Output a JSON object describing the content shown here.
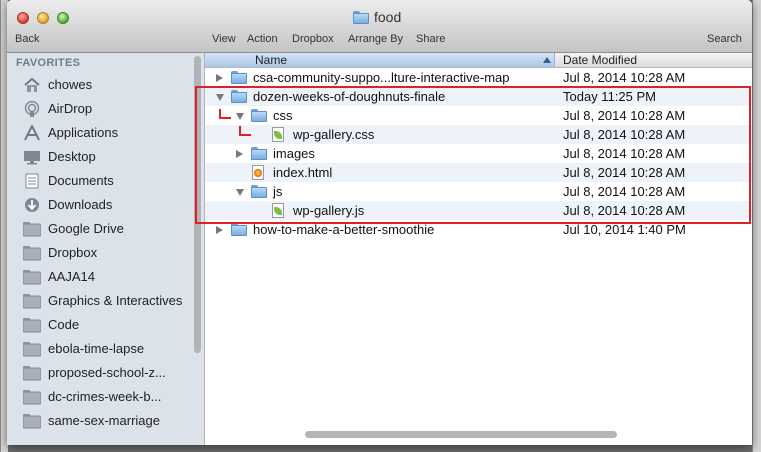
{
  "window": {
    "title": "food"
  },
  "toolbar": {
    "back_label": "Back",
    "view_label": "View",
    "action_label": "Action",
    "dropbox_label": "Dropbox",
    "arrange_label": "Arrange By",
    "share_label": "Share",
    "search_label": "Search"
  },
  "sidebar": {
    "heading": "FAVORITES",
    "items": [
      {
        "label": "chowes",
        "icon": "home-icon"
      },
      {
        "label": "AirDrop",
        "icon": "airdrop-icon"
      },
      {
        "label": "Applications",
        "icon": "applications-icon"
      },
      {
        "label": "Desktop",
        "icon": "desktop-icon"
      },
      {
        "label": "Documents",
        "icon": "documents-icon"
      },
      {
        "label": "Downloads",
        "icon": "downloads-icon"
      },
      {
        "label": "Google Drive",
        "icon": "folder-icon"
      },
      {
        "label": "Dropbox",
        "icon": "folder-icon"
      },
      {
        "label": "AAJA14",
        "icon": "folder-icon"
      },
      {
        "label": "Graphics & Interactives",
        "icon": "folder-icon"
      },
      {
        "label": "Code",
        "icon": "folder-icon"
      },
      {
        "label": "ebola-time-lapse",
        "icon": "folder-icon"
      },
      {
        "label": "proposed-school-z...",
        "icon": "folder-icon"
      },
      {
        "label": "dc-crimes-week-b...",
        "icon": "folder-icon"
      },
      {
        "label": "same-sex-marriage",
        "icon": "folder-icon"
      }
    ]
  },
  "columns": {
    "name": "Name",
    "date": "Date Modified"
  },
  "files": [
    {
      "name": "csa-community-suppo...lture-interactive-map",
      "date": "Jul 8, 2014 10:28 AM",
      "kind": "folder",
      "state": "closed",
      "indent": 0
    },
    {
      "name": "dozen-weeks-of-doughnuts-finale",
      "date": "Today 11:25 PM",
      "kind": "folder",
      "state": "open",
      "indent": 0
    },
    {
      "name": "css",
      "date": "Jul 8, 2014 10:28 AM",
      "kind": "folder",
      "state": "open",
      "indent": 1
    },
    {
      "name": "wp-gallery.css",
      "date": "Jul 8, 2014 10:28 AM",
      "kind": "css-file",
      "state": "none",
      "indent": 2
    },
    {
      "name": "images",
      "date": "Jul 8, 2014 10:28 AM",
      "kind": "folder",
      "state": "closed",
      "indent": 1
    },
    {
      "name": "index.html",
      "date": "Jul 8, 2014 10:28 AM",
      "kind": "html-file",
      "state": "none",
      "indent": 1
    },
    {
      "name": "js",
      "date": "Jul 8, 2014 10:28 AM",
      "kind": "folder",
      "state": "open",
      "indent": 1
    },
    {
      "name": "wp-gallery.js",
      "date": "Jul 8, 2014 10:28 AM",
      "kind": "js-file",
      "state": "none",
      "indent": 2
    },
    {
      "name": "how-to-make-a-better-smoothie",
      "date": "Jul 10, 2014 1:40 PM",
      "kind": "folder",
      "state": "closed",
      "indent": 0
    }
  ],
  "colors": {
    "highlight_box": "#e01f26",
    "sidebar_bg": "#dce2e9",
    "row_alt": "#eef3fa"
  }
}
